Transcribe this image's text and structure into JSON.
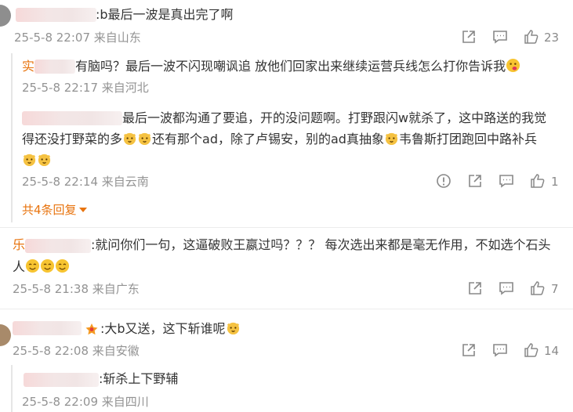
{
  "comments": [
    {
      "text": ":b最后一波是真出完了啊",
      "meta": "25-5-8 22:07 来自山东",
      "likes": "23"
    },
    {
      "text": "有脑吗？最后一波不闪现嘲讽追 放他们回家出来继续运营兵线怎么打你告诉我",
      "meta": "25-5-8 22:17 来自河北"
    },
    {
      "line1": "最后一波都沟通了要追，开的没问题啊。打野跟闪w就杀了，这中路送的我觉",
      "line2a": "得还没打野菜的多",
      "line2b": "还有那个ad，除了卢锡安，别的ad真抽象",
      "line2c": "韦鲁斯打团跑回中路补兵",
      "meta": "25-5-8 22:14 来自云南",
      "likes": "1",
      "expand": "共4条回复"
    },
    {
      "name_prefix": "乐",
      "line1": ":就问你们一句，这逼破败王嬴过吗？？？ 每次选出来都是毫无作用，不如选个石头",
      "line2": "人",
      "meta": "25-5-8 21:38 来自广东",
      "likes": "7"
    },
    {
      "text": ":大b又送，这下斩谁呢",
      "meta": "25-5-8 22:08 来自安徽",
      "likes": "14"
    },
    {
      "text": ":斩杀上下野辅",
      "meta": "25-5-8 22:09 来自四川"
    }
  ],
  "icons": [
    "share-icon",
    "comment-icon",
    "like-icon",
    "report-icon",
    "emoji-icon",
    "caret-down-icon"
  ],
  "colors": {
    "accent": "#e8740f",
    "meta": "#939393",
    "text": "#333333"
  }
}
